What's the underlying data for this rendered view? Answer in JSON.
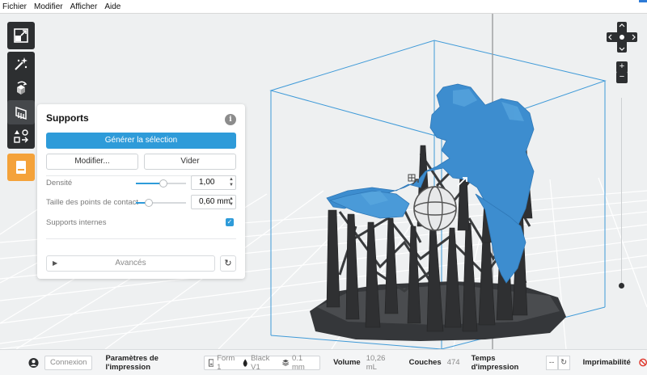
{
  "menu": {
    "items": [
      "Fichier",
      "Modifier",
      "Afficher",
      "Aide"
    ]
  },
  "toolbar": {
    "icons": [
      "scale-icon",
      "magic-wand-icon",
      "rotate-icon",
      "support-icon",
      "layout-icon",
      "print-icon"
    ]
  },
  "supports_panel": {
    "title": "Supports",
    "generate_label": "Générer la sélection",
    "modify_label": "Modifier...",
    "clear_label": "Vider",
    "density_label": "Densité",
    "density_value": "1,00",
    "density_level": 0.55,
    "touchpoint_label": "Taille des points de contact",
    "touchpoint_value": "0,60 mm",
    "touchpoint_level": 0.25,
    "internal_label": "Supports internes",
    "internal_checked": true,
    "advanced_label": "Avancés"
  },
  "statusbar": {
    "login_label": "Connexion",
    "print_settings_label": "Paramètres de l'impression",
    "printer": "Form 1",
    "resin": "Black V1",
    "layer_height": "0.1 mm",
    "volume_label": "Volume",
    "volume_value": "10,26 mL",
    "layers_label": "Couches",
    "layers_value": "474",
    "print_time_label": "Temps d'impression",
    "print_time_value": "--",
    "printability_label": "Imprimabilité"
  },
  "colors": {
    "accent": "#2e9bd9",
    "model": "#3d8dcf",
    "support": "#2f3032",
    "toolbar": "#2d2f31",
    "orange": "#f4a23a",
    "error": "#e0362b"
  }
}
